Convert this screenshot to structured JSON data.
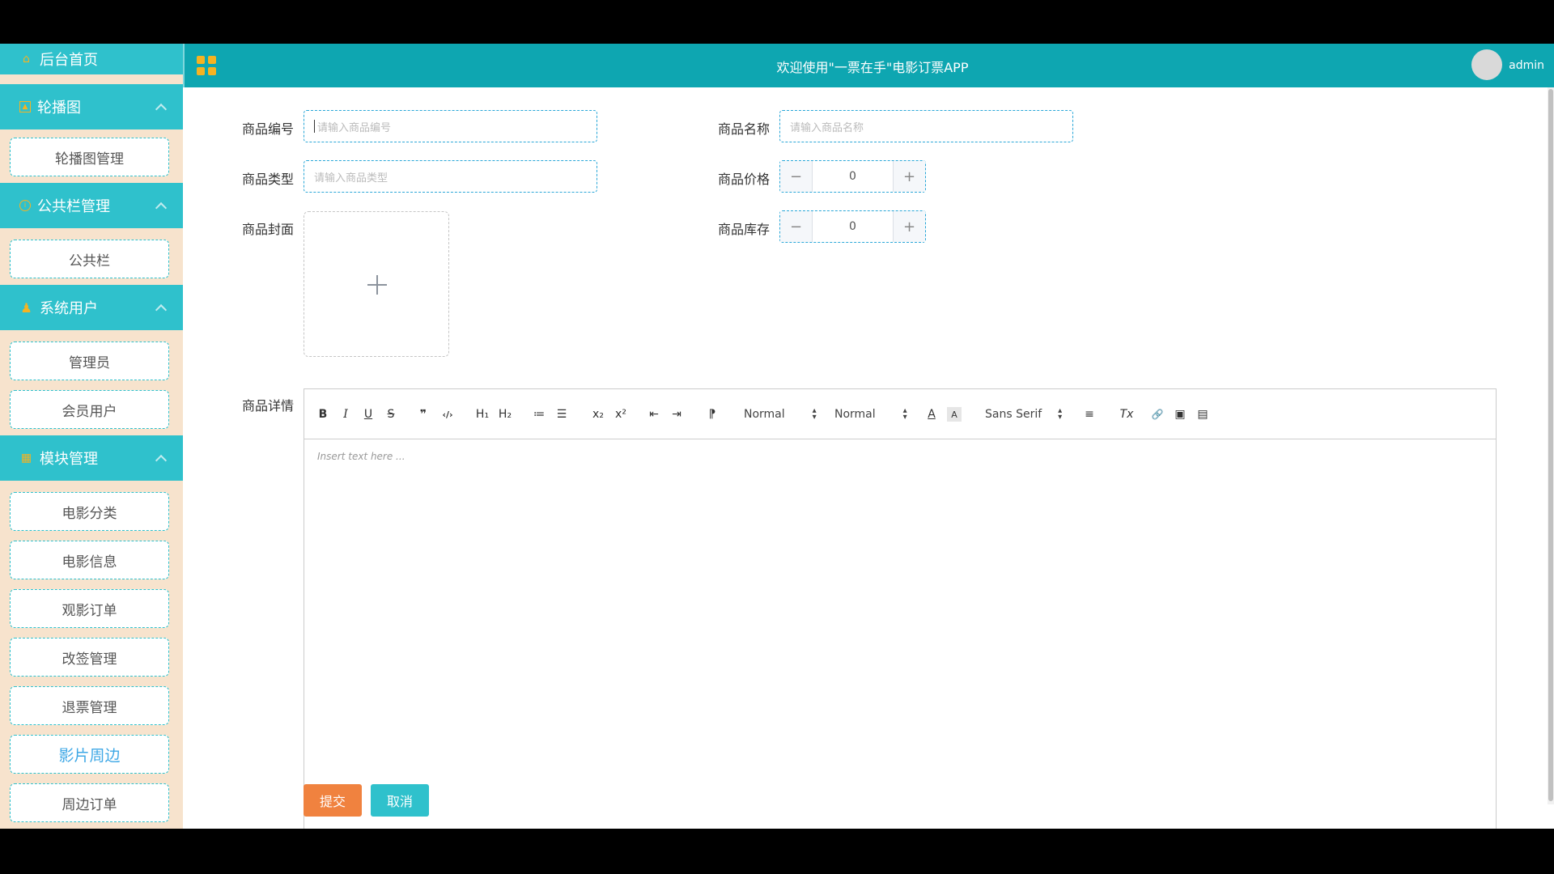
{
  "app": {
    "title": "欢迎使用\"一票在手\"电影订票APP",
    "user": "admin",
    "colors": {
      "primary": "#2fc1cc",
      "header": "#0ea6b1",
      "sidebar_bg": "#f7e3cd",
      "submit": "#f0823f",
      "active_link": "#3fa8e6"
    }
  },
  "sidebar": {
    "home": {
      "label": "后台首页",
      "icon": "home-icon"
    },
    "groups": [
      {
        "label": "轮播图",
        "icon": "image-icon",
        "items": [
          "轮播图管理"
        ]
      },
      {
        "label": "公共栏管理",
        "icon": "info-icon",
        "items": [
          "公共栏"
        ]
      },
      {
        "label": "系统用户",
        "icon": "user-icon",
        "items": [
          "管理员",
          "会员用户"
        ]
      },
      {
        "label": "模块管理",
        "icon": "grid-icon",
        "items": [
          "电影分类",
          "电影信息",
          "观影订单",
          "改签管理",
          "退票管理",
          "影片周边",
          "周边订单"
        ]
      }
    ],
    "active_item": "影片周边"
  },
  "form": {
    "code": {
      "label": "商品编号",
      "placeholder": "请输入商品编号"
    },
    "name": {
      "label": "商品名称",
      "placeholder": "请输入商品名称"
    },
    "type": {
      "label": "商品类型",
      "placeholder": "请输入商品类型"
    },
    "price": {
      "label": "商品价格",
      "value": "0"
    },
    "cover": {
      "label": "商品封面"
    },
    "stock": {
      "label": "商品库存",
      "value": "0"
    },
    "detail": {
      "label": "商品详情"
    }
  },
  "editor": {
    "toolbar": {
      "bold": "B",
      "italic": "I",
      "underline": "U",
      "strike": "S",
      "quote": "❞",
      "code": "‹/›",
      "h1": "H₁",
      "h2": "H₂",
      "ordered_list": "≔",
      "bullet_list": "☰",
      "subscript": "x₂",
      "superscript": "x²",
      "outdent": "⇤",
      "indent": "⇥",
      "direction": "⁋",
      "size_select": "Normal",
      "header_select": "Normal",
      "color": "A",
      "background": "A",
      "font_select": "Sans Serif",
      "align": "≡",
      "clean": "Tx",
      "link": "🔗",
      "image": "▣",
      "video": "▤"
    },
    "placeholder": "Insert text here ..."
  },
  "buttons": {
    "submit": "提交",
    "cancel": "取消"
  }
}
